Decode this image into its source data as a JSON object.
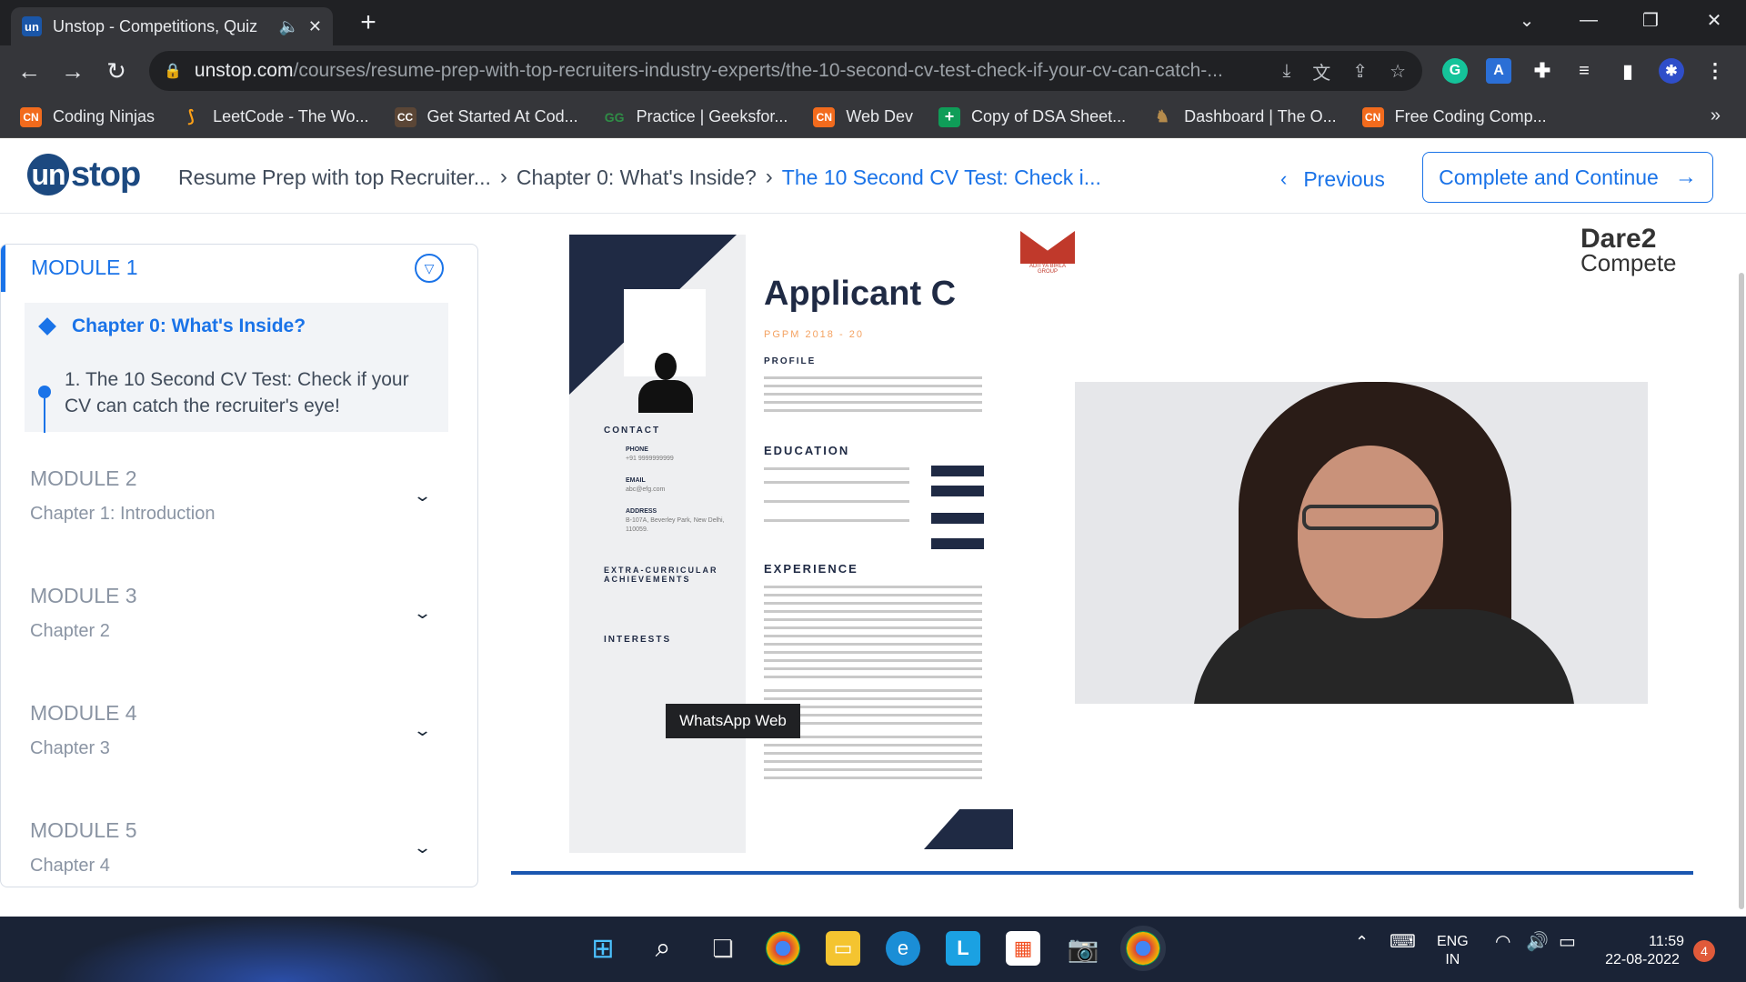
{
  "browser": {
    "tab_title": "Unstop - Competitions, Quiz",
    "tab_favicon": "un",
    "url_domain": "unstop.com",
    "url_path": "/courses/resume-prep-with-top-recruiters-industry-experts/the-10-second-cv-test-check-if-your-cv-can-catch-...",
    "bookmarks": [
      {
        "label": "Coding Ninjas",
        "icon": "CN",
        "color": "#f26b1d"
      },
      {
        "label": "LeetCode - The Wo...",
        "icon": "LC",
        "color": "#ffa116"
      },
      {
        "label": "Get Started At Cod...",
        "icon": "CC",
        "color": "#5b4636"
      },
      {
        "label": "Practice | Geeksfor...",
        "icon": "GG",
        "color": "#2f8d46"
      },
      {
        "label": "Web Dev",
        "icon": "CN",
        "color": "#f26b1d"
      },
      {
        "label": "Copy of DSA Sheet...",
        "icon": "+",
        "color": "#0f9d58"
      },
      {
        "label": "Dashboard | The O...",
        "icon": "O",
        "color": "#b58b4c"
      },
      {
        "label": "Free Coding Comp...",
        "icon": "CN",
        "color": "#f26b1d"
      }
    ],
    "bookmarks_more": "»"
  },
  "header": {
    "logo": "unstop",
    "breadcrumb": [
      "Resume Prep with top Recruiter...",
      "Chapter 0: What's Inside?",
      "The 10 Second CV Test: Check i..."
    ],
    "previous_label": "Previous",
    "continue_label": "Complete and Continue"
  },
  "sidebar": {
    "active_module": {
      "title": "MODULE 1",
      "chapter": "Chapter 0: What's Inside?",
      "lesson": "1. The 10 Second CV Test: Check if your CV can catch the recruiter's eye!"
    },
    "modules": [
      {
        "title": "MODULE 2",
        "chapter": "Chapter 1: Introduction"
      },
      {
        "title": "MODULE 3",
        "chapter": "Chapter 2"
      },
      {
        "title": "MODULE 4",
        "chapter": "Chapter 3"
      },
      {
        "title": "MODULE 5",
        "chapter": "Chapter 4"
      }
    ]
  },
  "content": {
    "resume": {
      "name": "Applicant C",
      "program": "PGPM 2018 - 20",
      "sections": {
        "profile": "PROFILE",
        "contact": "CONTACT",
        "education": "EDUCATION",
        "experience": "EXPERIENCE",
        "extra": "EXTRA-CURRICULAR ACHIEVEMENTS",
        "interests": "INTERESTS"
      },
      "contact": {
        "phone_label": "PHONE",
        "phone": "+91 9999999999",
        "email_label": "EMAIL",
        "email": "abc@efg.com",
        "address_label": "ADDRESS",
        "address": "B-107A, Beverley Park, New Delhi, 110059."
      }
    },
    "tooltip": "WhatsApp Web",
    "sponsor_logo": "ADITYA BIRLA GROUP",
    "brand_line1": "Dare2",
    "brand_line2": "Compete"
  },
  "taskbar": {
    "language": "ENG",
    "region": "IN",
    "time": "11:59",
    "date": "22-08-2022",
    "notifications": "4"
  }
}
